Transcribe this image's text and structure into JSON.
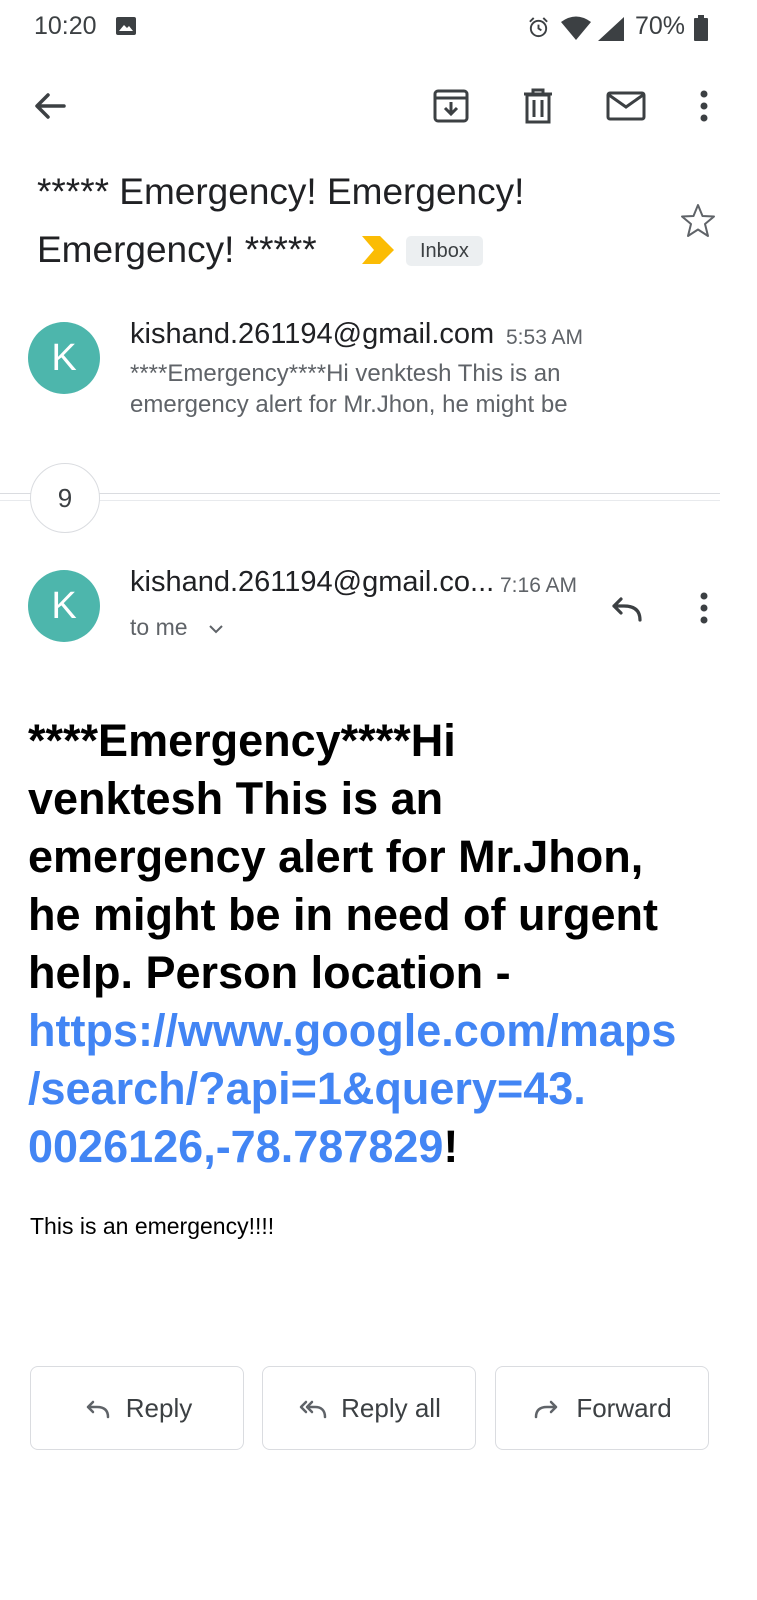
{
  "status_bar": {
    "time": "10:20",
    "battery_percent": "70%",
    "icons": [
      "image-notification-icon",
      "alarm-icon",
      "wifi-icon",
      "signal-icon",
      "battery-icon"
    ]
  },
  "toolbar": {
    "icons": [
      "back-arrow-icon",
      "archive-icon",
      "delete-icon",
      "mark-unread-icon",
      "more-options-icon"
    ]
  },
  "subject": {
    "line1": "***** Emergency! Emergency!",
    "line2": "Emergency! *****",
    "label": "Inbox",
    "starred": false
  },
  "thread": {
    "collapsed_message": {
      "avatar_letter": "K",
      "sender": "kishand.261194@gmail.com",
      "time": "5:53 AM",
      "snippet_line1": "****Emergency****Hi venktesh This is an",
      "snippet_line2": "emergency alert for Mr.Jhon, he might be"
    },
    "collapsed_count": "9",
    "expanded_message": {
      "avatar_letter": "K",
      "sender": "kishand.261194@gmail.co...",
      "time": "7:16 AM",
      "recipient": "to me",
      "body": {
        "line1": "****Emergency****Hi",
        "line2": "venktesh This is an",
        "line3": "emergency alert for Mr.Jhon,",
        "line4": "he might be in need of urgent",
        "line5": "help. Person location -",
        "link_line1": "https://www.google.com/maps",
        "link_line2": "/search/?api=1&query=43.",
        "link_line3": "0026126,-78.787829",
        "link_suffix": "!",
        "note": "This is an emergency!!!!"
      }
    }
  },
  "actions": {
    "reply": "Reply",
    "reply_all": "Reply all",
    "forward": "Forward"
  },
  "colors": {
    "avatar": "#4db6ac",
    "link": "#4285f4",
    "important_marker": "#fbbc04"
  }
}
